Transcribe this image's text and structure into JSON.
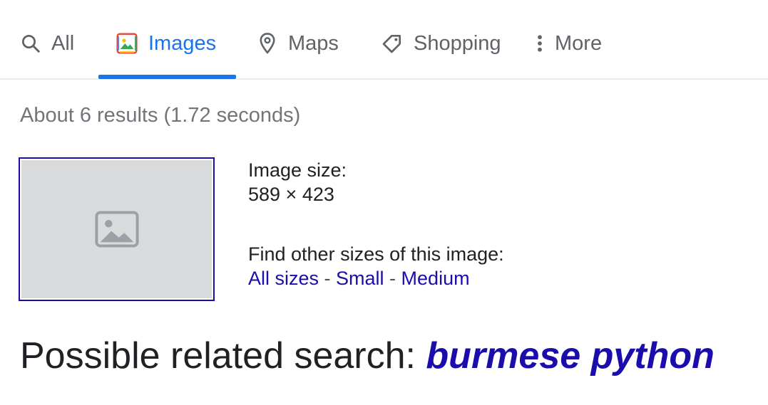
{
  "tabs": [
    {
      "label": "All",
      "icon": "search-icon",
      "active": false
    },
    {
      "label": "Images",
      "icon": "images-icon",
      "active": true
    },
    {
      "label": "Maps",
      "icon": "map-pin-icon",
      "active": false
    },
    {
      "label": "Shopping",
      "icon": "tag-icon",
      "active": false
    },
    {
      "label": "More",
      "icon": "more-vert-icon",
      "active": false
    }
  ],
  "colors": {
    "accent": "#1a73e8",
    "link": "#1a0dab",
    "muted": "#70757a"
  },
  "result_stats": "About 6 results (1.72 seconds)",
  "image_info": {
    "size_label": "Image size:",
    "size_value": "589 × 423",
    "other_sizes_label": "Find other sizes of this image:",
    "links": [
      "All sizes",
      "Small",
      "Medium"
    ],
    "separator": " - "
  },
  "related": {
    "label": "Possible related search: ",
    "query": "burmese python"
  }
}
